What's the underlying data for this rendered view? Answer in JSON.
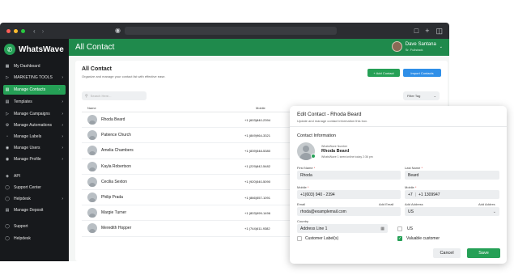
{
  "app": {
    "brand": "WhatsWave",
    "page_title": "All Contact"
  },
  "user": {
    "name": "Dave Santana",
    "role": "Sr. Fullstack"
  },
  "sidebar": {
    "items": [
      {
        "label": "My Dashboard",
        "icon": "dashboard-icon",
        "chevron": false,
        "active": false
      },
      {
        "label": "MARKETING TOOLS",
        "icon": "megaphone-icon",
        "chevron": true,
        "active": false
      },
      {
        "label": "Manage Contacts",
        "icon": "contacts-icon",
        "chevron": true,
        "active": true
      },
      {
        "label": "Templates",
        "icon": "template-icon",
        "chevron": true,
        "active": false
      },
      {
        "label": "Manage Campaigns",
        "icon": "campaign-icon",
        "chevron": true,
        "active": false
      },
      {
        "label": "Manage Automations",
        "icon": "automation-icon",
        "chevron": true,
        "active": false
      },
      {
        "label": "Manage Labels",
        "icon": "label-icon",
        "chevron": true,
        "active": false
      },
      {
        "label": "Manage Users",
        "icon": "users-icon",
        "chevron": true,
        "active": false
      },
      {
        "label": "Manage Profile",
        "icon": "profile-icon",
        "chevron": true,
        "active": false
      },
      {
        "label": "API",
        "icon": "api-icon",
        "chevron": false,
        "active": false
      },
      {
        "label": "Support Center",
        "icon": "support-icon",
        "chevron": false,
        "active": false
      },
      {
        "label": "Helpdesk",
        "icon": "helpdesk-icon",
        "chevron": true,
        "active": false
      },
      {
        "label": "Manage Deposit",
        "icon": "deposit-icon",
        "chevron": false,
        "active": false
      },
      {
        "label": "Support",
        "icon": "support-icon",
        "chevron": false,
        "active": false
      },
      {
        "label": "Helpdesk",
        "icon": "helpdesk-icon",
        "chevron": false,
        "active": false
      }
    ]
  },
  "contacts": {
    "title": "All Contact",
    "subtitle": "Organize and manage your contact list with effective ease.",
    "add_label": "+ Add Contact",
    "import_label": "Import Contacts",
    "search_placeholder": "Search Here...",
    "filter_label": "Filter Tag",
    "columns": [
      "Name",
      "Mobile"
    ],
    "rows": [
      {
        "name": "Rhoda Beard",
        "mobile": "+1 (603)840-2394"
      },
      {
        "name": "Patience Church",
        "mobile": "+1 (849)964-3321"
      },
      {
        "name": "Amelia Chambers",
        "mobile": "+1 (839)548-5380"
      },
      {
        "name": "Kayla Robertson",
        "mobile": "+1 (229)842-5482"
      },
      {
        "name": "Cecilia Sexton",
        "mobile": "+1 (920)540-5090"
      },
      {
        "name": "Philip Prada",
        "mobile": "+1 (866)557-1091"
      },
      {
        "name": "Margie Turner",
        "mobile": "+1 (803)999-1496"
      },
      {
        "name": "Meredith Hopper",
        "mobile": "+1 (744)611-9382"
      }
    ]
  },
  "modal": {
    "title": "Edit Contact - Rhoda Beard",
    "subtitle": "Update and manage contact information this box.",
    "section_title": "Contact Information",
    "whatsapp_caption": "WhatsWave Number",
    "whatsapp_name": "Rhoda Beard",
    "whatsapp_sub": "WhatsWave 1 seen/online today 2:36 pm",
    "first_name_label": "First Name",
    "first_name_value": "Rhoda",
    "last_name_label": "Last Name",
    "last_name_value": "Beard",
    "mobile_label": "Mobile",
    "mobile_value": "+1(603) 940 - 2394",
    "mobile2_label": "Mobile",
    "mobile2_code": "+7",
    "mobile2_value": "+1 1309947",
    "email_label": "Email",
    "email_hint": "Add Email",
    "email_value": "rhoda@examplemail.com",
    "address_label": "Add Address",
    "address_hint": "Add Addres",
    "address_value": "US",
    "country_label": "Country",
    "country_value": "Address Line 1",
    "us_label": "US",
    "customer_label": "Customer Label(s)",
    "valuable_label": "Valuable customer",
    "cancel_label": "Cancel",
    "save_label": "Save"
  },
  "colors": {
    "brand_green": "#25a056",
    "header_green": "#1f8a4c",
    "blue": "#2f8fe8",
    "sidebar": "#17191c"
  }
}
